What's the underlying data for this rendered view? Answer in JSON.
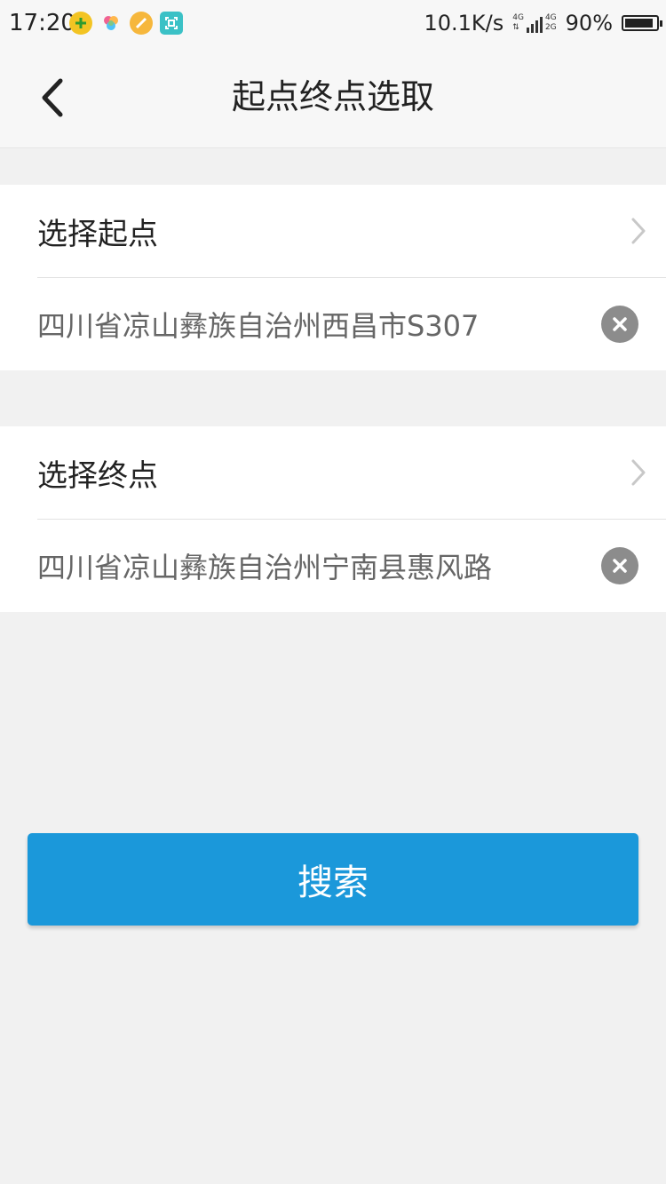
{
  "status_bar": {
    "time": "17:20",
    "network_speed": "10.1K/s",
    "net_type_top": "4G",
    "net_type_bottom": "2G",
    "net_type_left": "4G",
    "battery_percent": "90%",
    "battery_level": 0.9,
    "icons": [
      "plus-circle-icon",
      "pinwheel-icon",
      "paint-icon",
      "scan-icon"
    ]
  },
  "header": {
    "title": "起点终点选取",
    "back_icon": "chevron-left-icon"
  },
  "start": {
    "label": "选择起点",
    "value": "四川省凉山彝族自治州西昌市S307"
  },
  "end": {
    "label": "选择终点",
    "value": "四川省凉山彝族自治州宁南县惠风路"
  },
  "search_button": {
    "label": "搜索"
  },
  "colors": {
    "accent": "#1b98da",
    "background": "#f1f1f1",
    "header": "#f7f7f7"
  }
}
